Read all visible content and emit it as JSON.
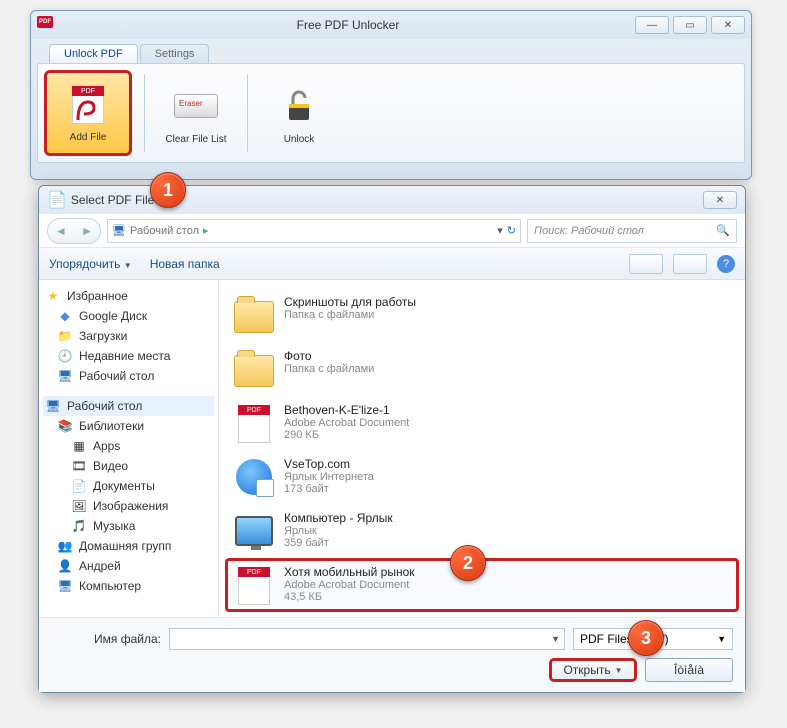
{
  "mainWindow": {
    "title": "Free PDF Unlocker",
    "tabs": {
      "unlock": "Unlock PDF",
      "settings": "Settings"
    },
    "ribbon": {
      "addFile": "Add File",
      "clearList": "Clear File List",
      "unlock": "Unlock"
    }
  },
  "dialog": {
    "title": "Select PDF File",
    "breadcrumb": "Рабочий стол",
    "searchPlaceholder": "Поиск: Рабочий стол",
    "toolbar": {
      "organize": "Упорядочить",
      "newFolder": "Новая папка"
    },
    "sidebar": {
      "favorites": "Избранное",
      "favItems": [
        "Google Диск",
        "Загрузки",
        "Недавние места",
        "Рабочий стол"
      ],
      "desktop": "Рабочий стол",
      "libraries": "Библиотеки",
      "libItems": [
        "Apps",
        "Видео",
        "Документы",
        "Изображения",
        "Музыка"
      ],
      "homegroup": "Домашняя групп",
      "user": "Андрей",
      "computer": "Компьютер"
    },
    "files": [
      {
        "name": "Скриншоты для работы",
        "type": "Папка с файлами",
        "size": "",
        "kind": "folder"
      },
      {
        "name": "Фото",
        "type": "Папка с файлами",
        "size": "",
        "kind": "folder"
      },
      {
        "name": "Bethoven-K-E'lize-1",
        "type": "Adobe Acrobat Document",
        "size": "290 КБ",
        "kind": "pdf"
      },
      {
        "name": "VseTop.com",
        "type": "Ярлык Интернета",
        "size": "173 байт",
        "kind": "url"
      },
      {
        "name": "Компьютер - Ярлык",
        "type": "Ярлык",
        "size": "359 байт",
        "kind": "computer"
      },
      {
        "name": "Хотя мобильный рынок",
        "type": "Adobe Acrobat Document",
        "size": "43,5 КБ",
        "kind": "pdf"
      }
    ],
    "fileNameLabel": "Имя файла:",
    "filter": "PDF Files (*.pdf)",
    "openBtn": "Открыть",
    "cancelBtn": "Îòìåíà"
  },
  "callouts": {
    "c1": "1",
    "c2": "2",
    "c3": "3"
  }
}
